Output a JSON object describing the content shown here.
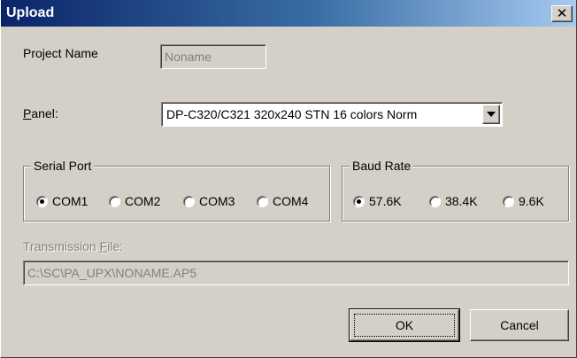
{
  "window": {
    "title": "Upload",
    "close_glyph": "✕"
  },
  "project": {
    "label": "Project Name",
    "value": "Noname"
  },
  "panel": {
    "label_prefix": "",
    "label_mnemonic": "P",
    "label_rest": "anel:",
    "selected": "DP-C320/C321 320x240 STN 16 colors Norm"
  },
  "serial_port": {
    "legend": "Serial Port",
    "options": [
      {
        "label": "COM1",
        "checked": true
      },
      {
        "label": "COM2",
        "checked": false
      },
      {
        "label": "COM3",
        "checked": false
      },
      {
        "label": "COM4",
        "checked": false
      }
    ]
  },
  "baud_rate": {
    "legend": "Baud Rate",
    "options": [
      {
        "label": "57.6K",
        "checked": true
      },
      {
        "label": "38.4K",
        "checked": false
      },
      {
        "label": "9.6K",
        "checked": false
      }
    ]
  },
  "transmission": {
    "label_prefix": "Transmission ",
    "label_mnemonic": "F",
    "label_rest": "ile:",
    "value": "C:\\SC\\PA_UPX\\NONAME.AP5"
  },
  "buttons": {
    "ok": "OK",
    "cancel": "Cancel"
  }
}
